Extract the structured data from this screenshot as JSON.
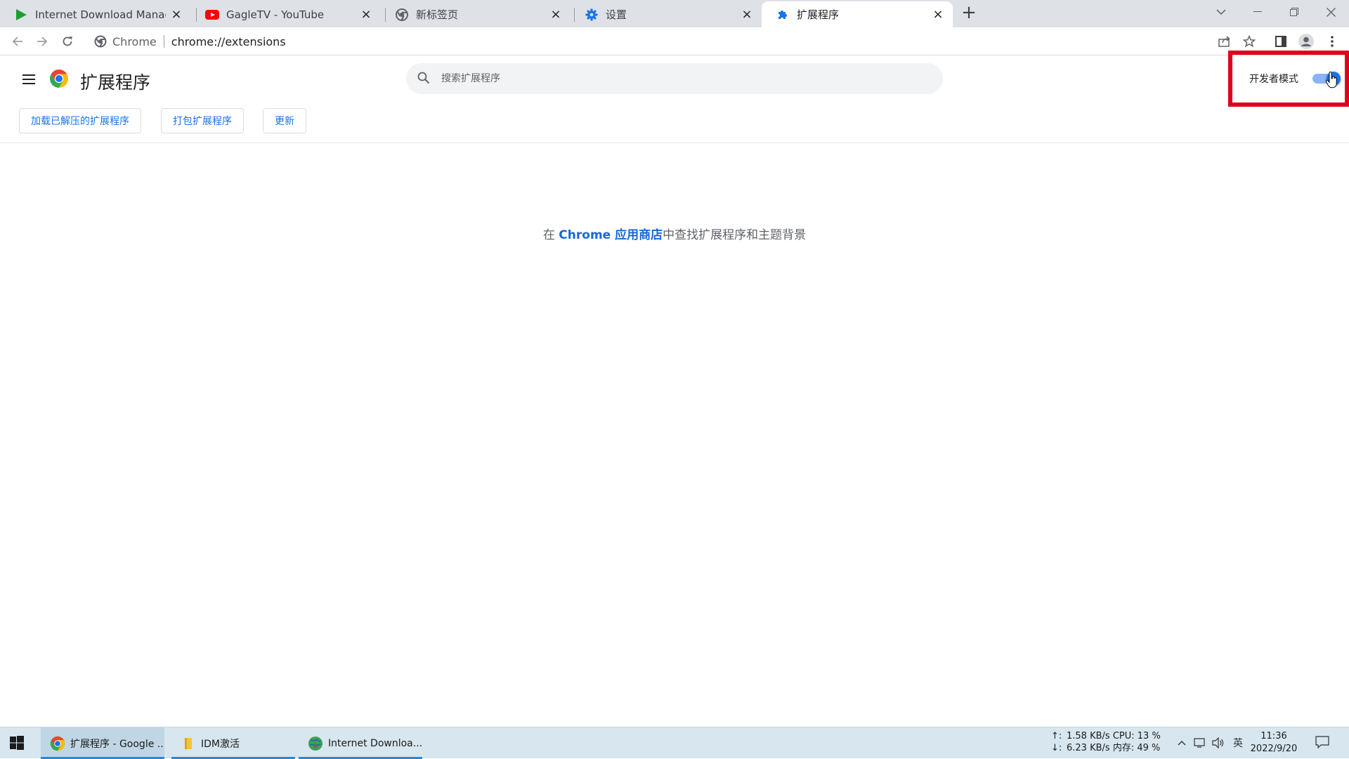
{
  "browser": {
    "tabs": [
      {
        "title": "Internet Download Manager N",
        "icon": "idm-play-icon",
        "active": false
      },
      {
        "title": "GagleTV - YouTube",
        "icon": "youtube-icon",
        "active": false
      },
      {
        "title": "新标签页",
        "icon": "chrome-icon",
        "active": false
      },
      {
        "title": "设置",
        "icon": "gear-icon",
        "active": false
      },
      {
        "title": "扩展程序",
        "icon": "puzzle-icon",
        "active": true
      }
    ],
    "new_tab": "+",
    "omnibox": {
      "chip": "Chrome",
      "url": "chrome://extensions"
    }
  },
  "page": {
    "title": "扩展程序",
    "search_placeholder": "搜索扩展程序",
    "dev_mode_label": "开发者模式",
    "dev_mode_enabled": true,
    "buttons": {
      "load_unpacked": "加载已解压的扩展程序",
      "pack": "打包扩展程序",
      "update": "更新"
    },
    "store_line": {
      "prefix": "在 ",
      "link": "Chrome 应用商店",
      "suffix": "中查找扩展程序和主题背景"
    }
  },
  "taskbar": {
    "tasks": [
      {
        "label": "扩展程序 - Google ...",
        "icon": "chrome-icon"
      },
      {
        "label": "IDM激活",
        "icon": "folder-icon"
      },
      {
        "label": "Internet Downloa...",
        "icon": "idm-globe-icon"
      }
    ],
    "net": {
      "up_arrow": "↑:",
      "up": "1.58 KB/s",
      "cpu": "CPU: 13 %",
      "down_arrow": "↓:",
      "down": "6.23 KB/s",
      "mem": "内存: 49 %"
    },
    "ime": "英",
    "time": "11:36",
    "date": "2022/9/20"
  },
  "colors": {
    "accent": "#1a73e8",
    "highlight_box": "#e0001b",
    "taskbar": "#d7e6ef"
  }
}
